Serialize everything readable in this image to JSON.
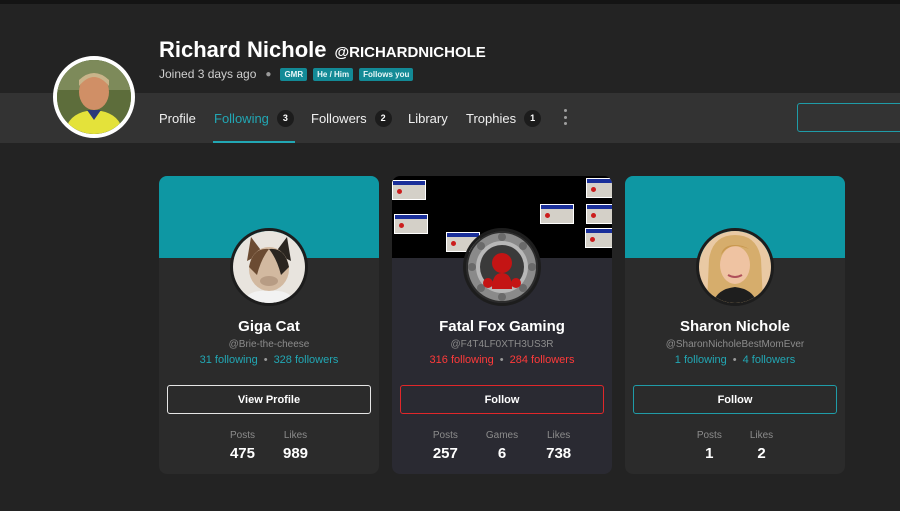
{
  "profile": {
    "display_name": "Richard Nichole",
    "handle": "@RICHARDNICHOLE",
    "joined": "Joined 3 days ago",
    "badges": [
      "GMR",
      "He / Him",
      "Follows you"
    ]
  },
  "tabs": [
    {
      "label": "Profile",
      "count": null,
      "active": false
    },
    {
      "label": "Following",
      "count": "3",
      "active": true
    },
    {
      "label": "Followers",
      "count": "2",
      "active": false
    },
    {
      "label": "Library",
      "count": null,
      "active": false
    },
    {
      "label": "Trophies",
      "count": "1",
      "active": false
    }
  ],
  "icons": {
    "more": "kebab-menu-icon"
  },
  "cards": [
    {
      "name": "Giga Cat",
      "handle": "@Brie-the-cheese",
      "following": "31 following",
      "followers": "328 followers",
      "button": "View Profile",
      "stats": [
        {
          "label": "Posts",
          "value": "475"
        },
        {
          "label": "Likes",
          "value": "989"
        }
      ]
    },
    {
      "name": "Fatal Fox Gaming",
      "handle": "@F4T4LF0XTH3US3R",
      "following": "316 following",
      "followers": "284 followers",
      "button": "Follow",
      "stats": [
        {
          "label": "Posts",
          "value": "257"
        },
        {
          "label": "Games",
          "value": "6"
        },
        {
          "label": "Likes",
          "value": "738"
        }
      ]
    },
    {
      "name": "Sharon Nichole",
      "handle": "@SharonNicholeBestMomEver",
      "following": "1 following",
      "followers": "4 followers",
      "button": "Follow",
      "stats": [
        {
          "label": "Posts",
          "value": "1"
        },
        {
          "label": "Likes",
          "value": "2"
        }
      ]
    }
  ],
  "colors": {
    "accent": "#22a7b4",
    "banner": "#0e97a3",
    "danger": "#ff3a3a",
    "background": "#232323",
    "tabbar": "#333333"
  }
}
